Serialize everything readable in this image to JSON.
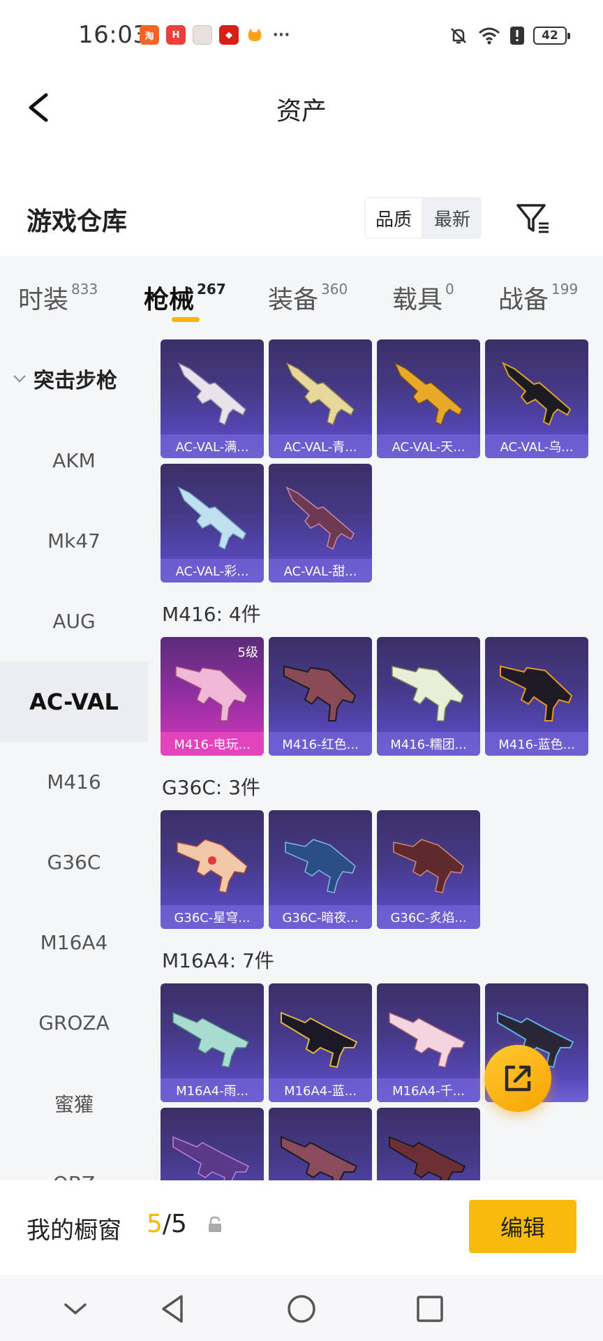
{
  "status_bar": {
    "time": "16:03",
    "notif_icons": [
      "taobao-icon",
      "huawei-icon",
      "gift-icon",
      "app-icon",
      "cat-icon"
    ],
    "more": "···",
    "battery": "42"
  },
  "header": {
    "title": "资产"
  },
  "warehouse": {
    "title": "游戏仓库",
    "sort": {
      "quality": "品质",
      "newest": "最新"
    }
  },
  "tabs": [
    {
      "label": "时装",
      "count": "833"
    },
    {
      "label": "枪械",
      "count": "267"
    },
    {
      "label": "装备",
      "count": "360"
    },
    {
      "label": "载具",
      "count": "0"
    },
    {
      "label": "战备",
      "count": "199"
    }
  ],
  "sidebar": {
    "heading": "突击步枪",
    "items": [
      "AKM",
      "Mk47",
      "AUG",
      "AC-VAL",
      "M416",
      "G36C",
      "M16A4",
      "GROZA",
      "蜜獾",
      "QBZ"
    ]
  },
  "groups": {
    "acval": {
      "items": [
        "AC-VAL-满...",
        "AC-VAL-青...",
        "AC-VAL-天...",
        "AC-VAL-乌...",
        "AC-VAL-彩...",
        "AC-VAL-甜..."
      ]
    },
    "m416": {
      "title": "M416: 4件",
      "items": [
        "M416-电玩...",
        "M416-红色...",
        "M416-糯团...",
        "M416-蓝色..."
      ],
      "level_badge": "5级"
    },
    "g36c": {
      "title": "G36C: 3件",
      "items": [
        "G36C-星穹...",
        "G36C-暗夜...",
        "G36C-炙焰..."
      ]
    },
    "m16a4": {
      "title": "M16A4: 7件",
      "items": [
        "M16A4-雨...",
        "M16A4-蓝...",
        "M16A4-千..."
      ]
    }
  },
  "bottom": {
    "window_label": "我的橱窗",
    "count_current": "5",
    "count_sep_total": "/5",
    "edit_button": "编辑"
  },
  "colors": {
    "accent": "#f8bb0c",
    "card_purple": "#463a8a",
    "card_pink": "#d63ab9"
  }
}
